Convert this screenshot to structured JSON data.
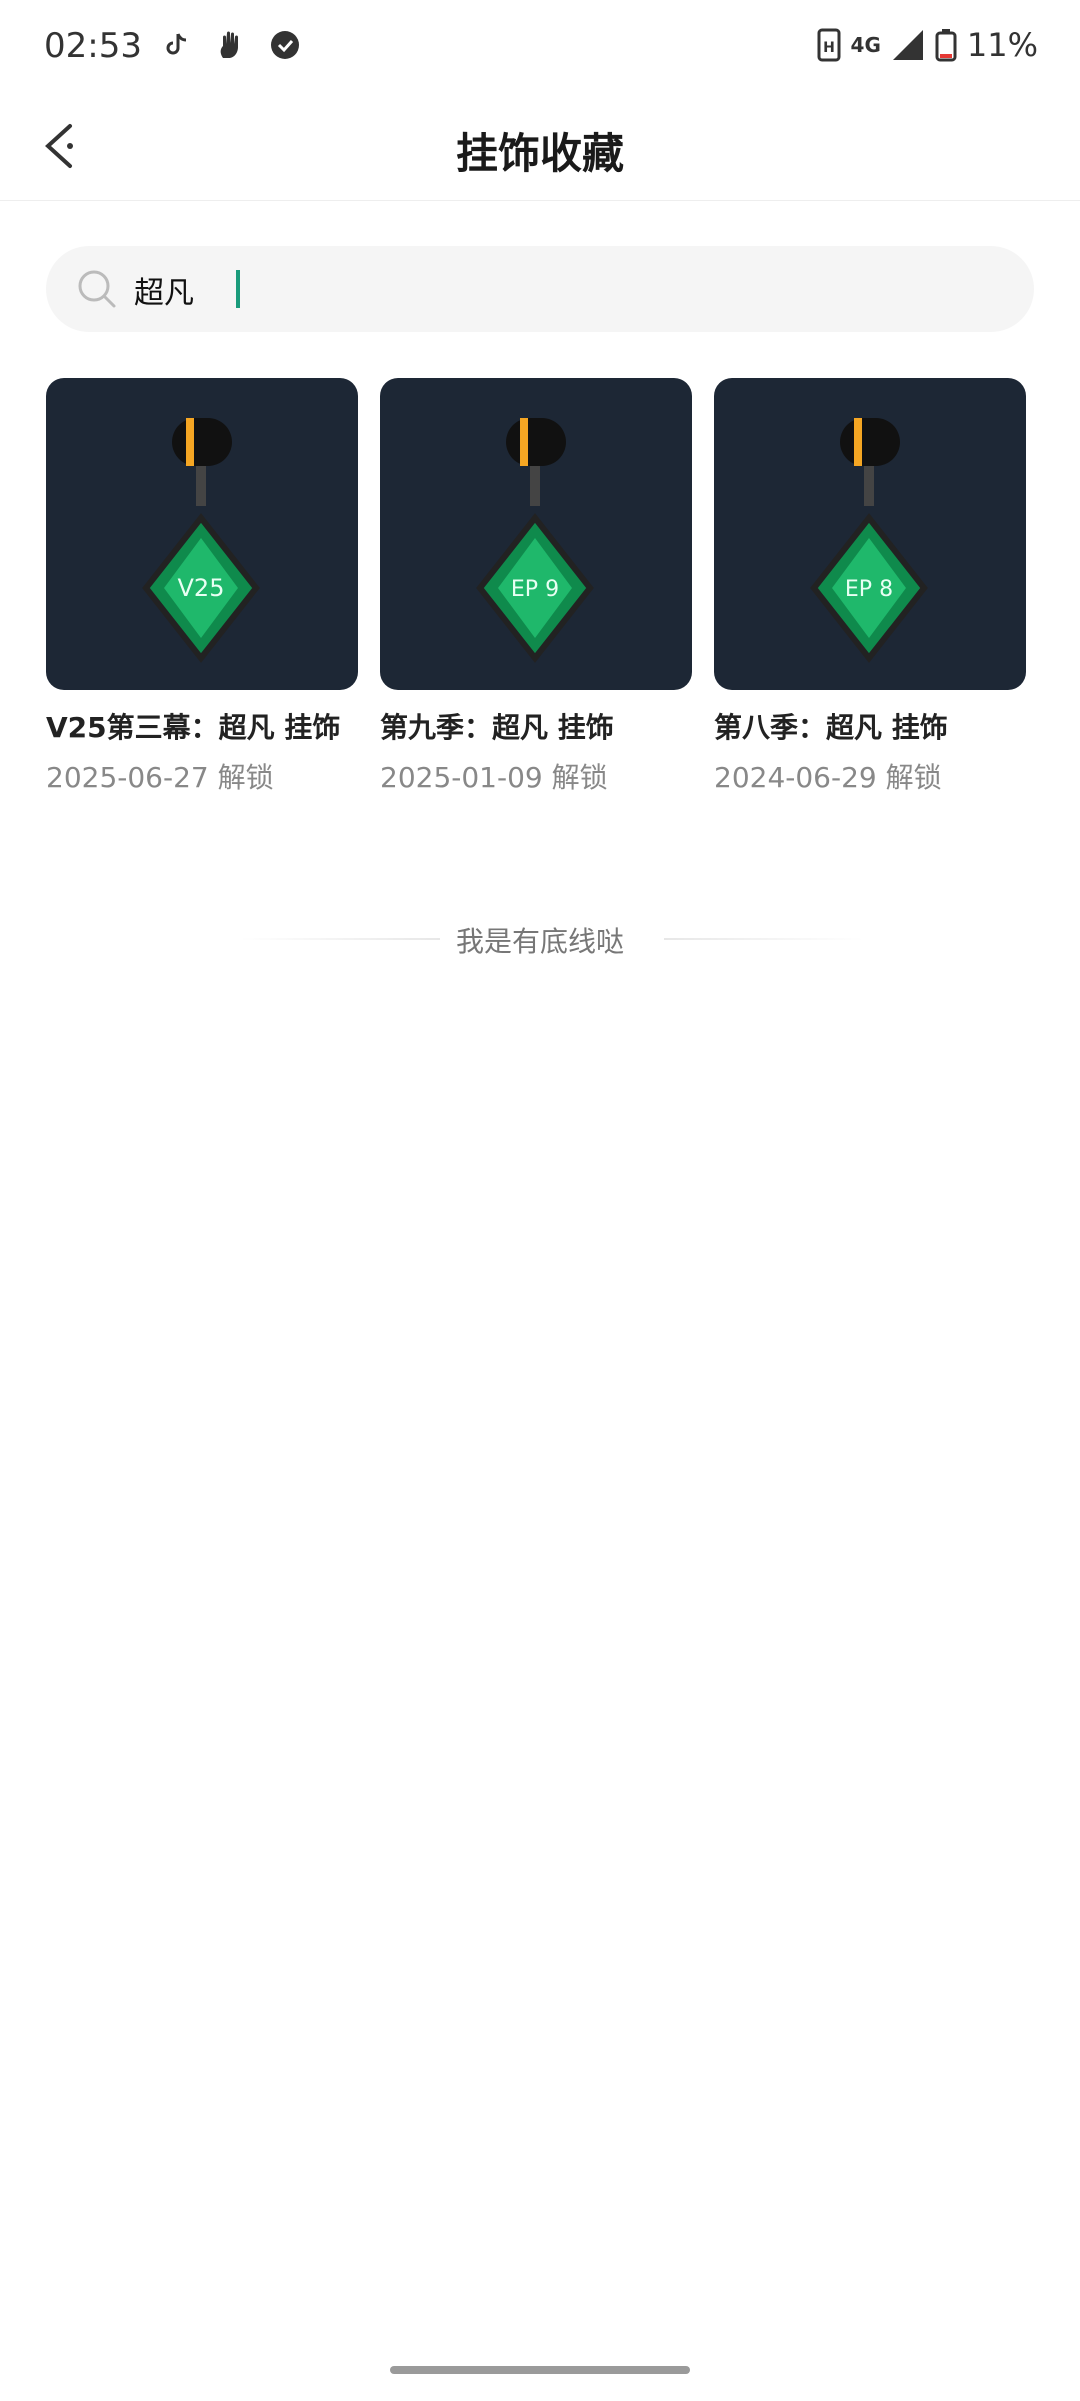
{
  "status_bar": {
    "time": "02:53",
    "network": "4G",
    "battery": "11%",
    "app_icons": [
      "tiktok-icon",
      "hand-icon",
      "shield-icon"
    ]
  },
  "header": {
    "title": "挂饰收藏",
    "back_icon": "back-chevron-icon"
  },
  "search": {
    "value": "超凡",
    "placeholder": ""
  },
  "items": [
    {
      "title": "V25第三幕：超凡 挂饰",
      "date": "2025-06-27 解锁",
      "badge": "V25"
    },
    {
      "title": "第九季：超凡 挂饰",
      "date": "2025-01-09 解锁",
      "badge": "EP 9"
    },
    {
      "title": "第八季：超凡 挂饰",
      "date": "2024-06-29 解锁",
      "badge": "EP 8"
    }
  ],
  "footer": {
    "end_text": "我是有底线哒"
  },
  "colors": {
    "accent": "#1a9b7b",
    "card_bg": "#1d2735",
    "gem": "#0f8a4c"
  }
}
